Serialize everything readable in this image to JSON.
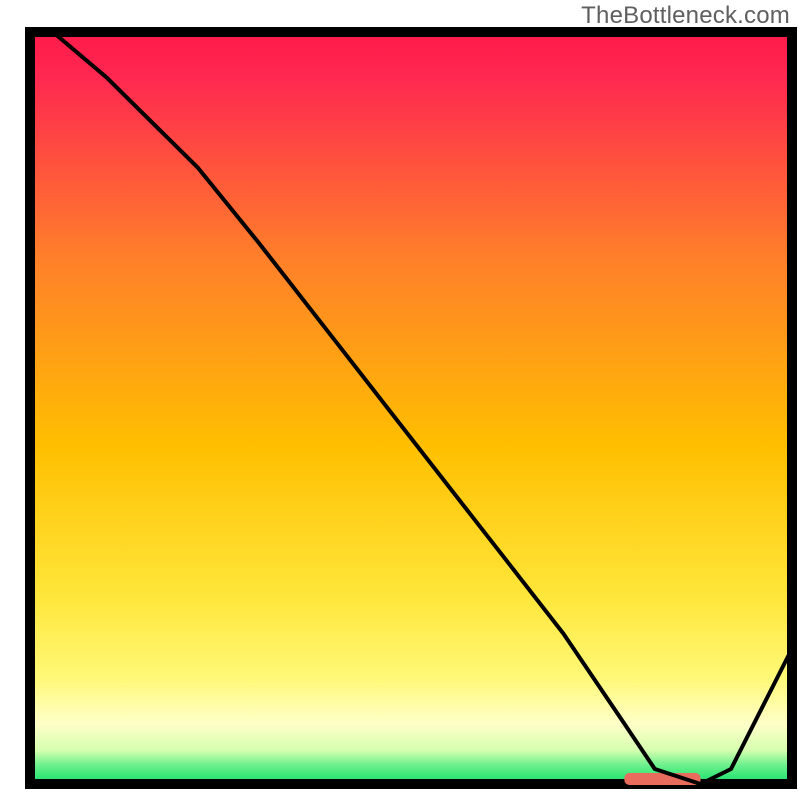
{
  "watermark": "TheBottleneck.com",
  "colors": {
    "top": "#ff1a4a",
    "mid": "#ffb300",
    "low": "#ffff60",
    "pale": "#fdffd8",
    "green": "#14e06a",
    "border": "#000000",
    "line": "#000000",
    "marker": "#e96b5e"
  },
  "chart_data": {
    "type": "line",
    "title": "",
    "xlabel": "",
    "ylabel": "",
    "xlim": [
      0,
      100
    ],
    "ylim": [
      0,
      100
    ],
    "x": [
      3,
      10,
      22,
      30,
      40,
      50,
      60,
      70,
      78,
      82,
      88,
      92,
      100
    ],
    "values": [
      100,
      94,
      82,
      72,
      59,
      46,
      33,
      20,
      8,
      2,
      0,
      2,
      18
    ],
    "annotations": [
      {
        "type": "highlight-segment",
        "x_start": 78,
        "x_end": 88,
        "y": 0
      }
    ]
  }
}
